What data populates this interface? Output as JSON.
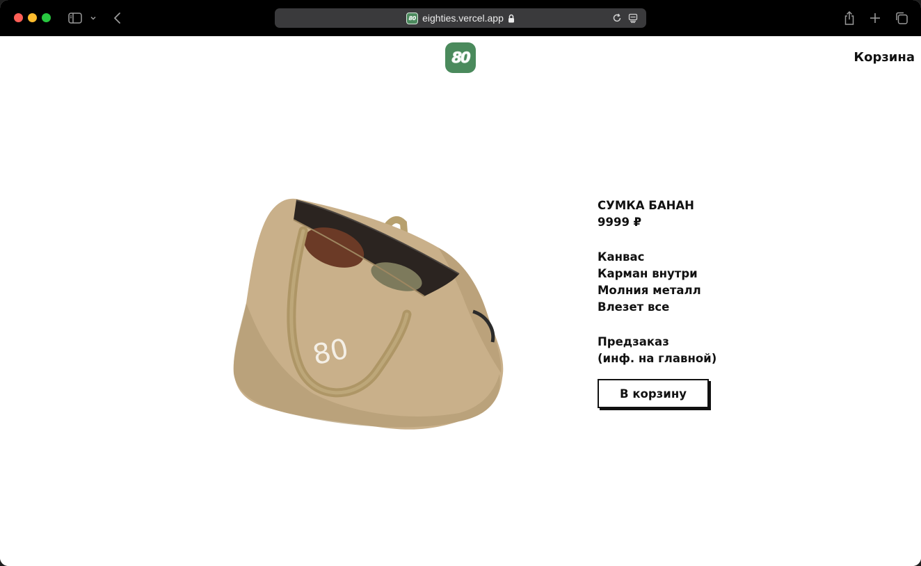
{
  "browser": {
    "url": "eighties.vercel.app",
    "favicon_text": "80",
    "icons": {
      "sidebar": "sidebar-icon",
      "chevron": "chevron-down-icon",
      "back": "back-arrow-icon",
      "lock": "lock-icon",
      "reload": "reload-icon",
      "reader": "reader-icon",
      "share": "share-icon",
      "new_tab": "plus-icon",
      "tabs": "tabs-overview-icon"
    }
  },
  "site": {
    "logo_text": "80",
    "logo_color": "#4a8a5c",
    "cart_link": "Корзина"
  },
  "product": {
    "name": "СУМКА БАНАН",
    "price": "9999 ₽",
    "image_print": "80",
    "features": [
      "Канвас",
      "Карман внутри",
      "Молния металл",
      "Влезет все"
    ],
    "status_line1": "Предзаказ",
    "status_line2": "(инф. на главной)",
    "add_to_cart_label": "В корзину"
  }
}
